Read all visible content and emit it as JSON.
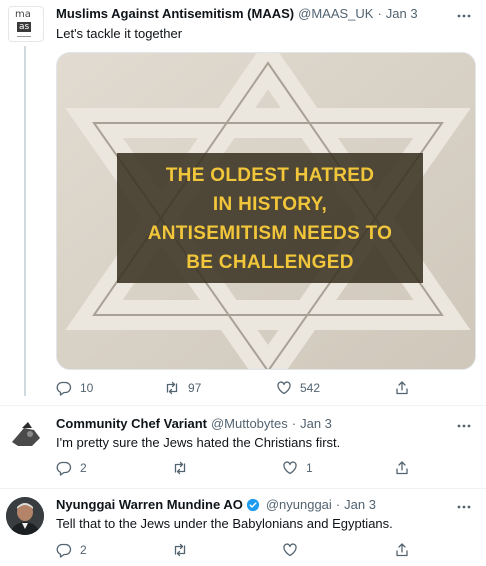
{
  "tweets": [
    {
      "name": "Muslims Against Antisemitism (MAAS)",
      "handle": "@MAAS_UK",
      "time": "Jan 3",
      "text": "Let's tackle it together",
      "avatar_text": [
        "ma",
        "as"
      ],
      "media_caption": [
        "THE OLDEST HATRED",
        "IN HISTORY,",
        "ANTISEMITISM NEEDS TO",
        "BE CHALLENGED"
      ],
      "replies": "10",
      "retweets": "97",
      "likes": "542"
    },
    {
      "name": "Community Chef Variant",
      "handle": "@Muttobytes",
      "time": "Jan 3",
      "text": "I'm pretty sure the Jews hated the Christians first.",
      "replies": "2",
      "retweets": "",
      "likes": "1"
    },
    {
      "name": "Nyunggai Warren Mundine AO",
      "handle": "@nyunggai",
      "time": "Jan 3",
      "text": "Tell that to the Jews under the Babylonians and Egyptians.",
      "replies": "2",
      "retweets": "",
      "likes": ""
    }
  ],
  "separator": "·",
  "colors": {
    "text": "#0f1419",
    "muted": "#536471",
    "verified": "#1d9bf0",
    "caption": "#f1c63a"
  }
}
